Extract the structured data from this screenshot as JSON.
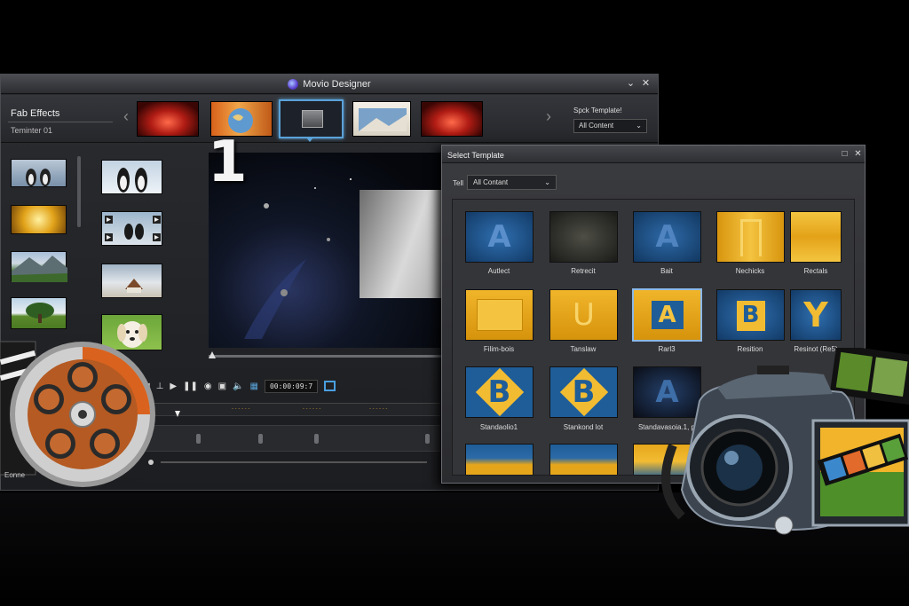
{
  "app": {
    "title": "Movio Designer"
  },
  "effects": {
    "title": "Fab Effects",
    "subtitle": "Teminter 01",
    "stock_label": "Spck Template!",
    "stock_value": "All Content"
  },
  "player": {
    "preview_number": "1",
    "timecode": "00:00:09:7"
  },
  "dialog": {
    "title": "Select Template",
    "filter_label": "Tell",
    "filter_value": "All Contant",
    "templates": [
      {
        "label": "Autlect",
        "glyph": "A"
      },
      {
        "label": "Retrecit",
        "glyph": ""
      },
      {
        "label": "Bait",
        "glyph": "A"
      },
      {
        "label": "Nechicks",
        "glyph": ""
      },
      {
        "label": "Rectals",
        "glyph": ""
      },
      {
        "label": "Filim-bois",
        "glyph": ""
      },
      {
        "label": "Tanslaw",
        "glyph": "U"
      },
      {
        "label": "Rarl3",
        "glyph": "A"
      },
      {
        "label": "Resition",
        "glyph": "B"
      },
      {
        "label": "Resinot (Re5)",
        "glyph": "Y"
      },
      {
        "label": "Standaolio1",
        "glyph": "B"
      },
      {
        "label": "Stankond lot",
        "glyph": "B"
      },
      {
        "label": "Standavasoia.1, p",
        "glyph": "A"
      },
      {
        "label": "",
        "glyph": ""
      },
      {
        "label": "",
        "glyph": ""
      }
    ]
  },
  "decor": {
    "reel_caption": "Eonne"
  },
  "colors": {
    "accent_blue": "#5aa2d8",
    "template_gold": "#e7a91c",
    "template_blue": "#1f5d98"
  }
}
